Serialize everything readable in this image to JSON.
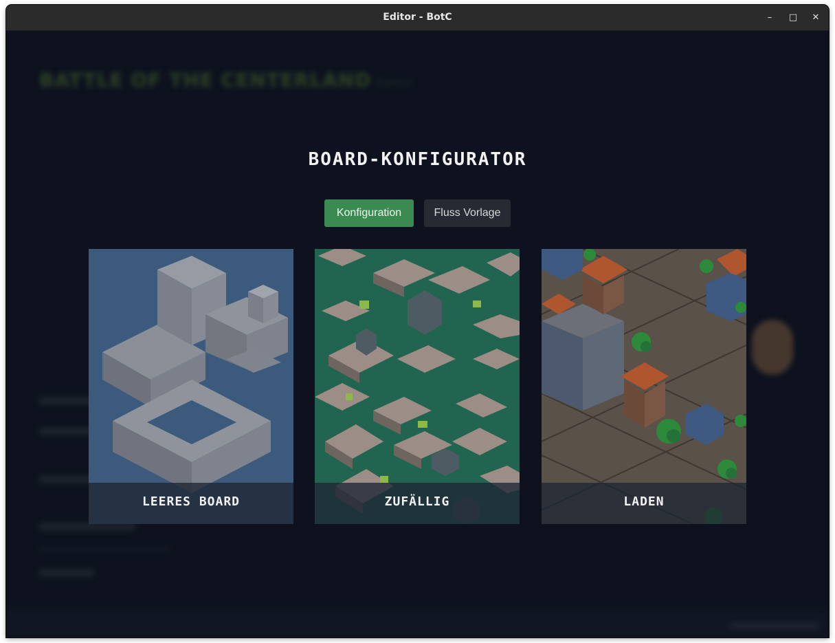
{
  "window": {
    "title": "Editor - BotC",
    "controls": {
      "minimize": "–",
      "maximize": "□",
      "close": "✕"
    }
  },
  "background": {
    "app_title": "BATTLE OF THE CENTERLAND",
    "app_subtitle": "Editor"
  },
  "main": {
    "heading": "BOARD-KONFIGURATOR",
    "tabs": [
      {
        "label": "Konfiguration",
        "active": true
      },
      {
        "label": "Fluss Vorlage",
        "active": false
      }
    ],
    "cards": [
      {
        "label": "LEERES BOARD",
        "theme": "blue-blocks"
      },
      {
        "label": "ZUFÄLLIG",
        "theme": "green-city"
      },
      {
        "label": "LADEN",
        "theme": "stone-village"
      }
    ]
  },
  "colors": {
    "window_bg": "#0e1320",
    "active_tab": "#3a8a52",
    "inactive_tab": "#262b33",
    "card_blue": "#3c5a7c",
    "card_green": "#21644f",
    "card_stone": "#5a5148"
  }
}
